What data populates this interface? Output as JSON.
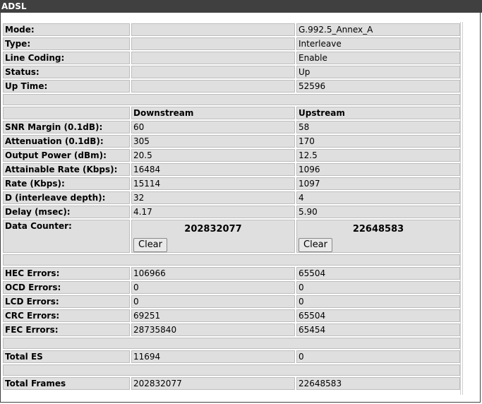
{
  "header": {
    "title": "ADSL"
  },
  "info_rows": [
    {
      "label": "Mode:",
      "value": "G.992.5_Annex_A"
    },
    {
      "label": "Type:",
      "value": "Interleave"
    },
    {
      "label": "Line Coding:",
      "value": "Enable"
    },
    {
      "label": "Status:",
      "value": "Up"
    },
    {
      "label": "Up Time:",
      "value": "52596"
    }
  ],
  "columns": {
    "downstream": "Downstream",
    "upstream": "Upstream"
  },
  "stats_rows": [
    {
      "label": "SNR Margin (0.1dB):",
      "down": "60",
      "up": "58"
    },
    {
      "label": "Attenuation (0.1dB):",
      "down": "305",
      "up": "170"
    },
    {
      "label": "Output Power (dBm):",
      "down": "20.5",
      "up": "12.5"
    },
    {
      "label": "Attainable Rate (Kbps):",
      "down": "16484",
      "up": "1096"
    },
    {
      "label": "Rate (Kbps):",
      "down": "15114",
      "up": "1097"
    },
    {
      "label": "D (interleave depth):",
      "down": "32",
      "up": "4"
    },
    {
      "label": "Delay (msec):",
      "down": "4.17",
      "up": "5.90"
    }
  ],
  "data_counter": {
    "label": "Data Counter:",
    "down": "202832077",
    "up": "22648583",
    "clear_label": "Clear"
  },
  "error_rows": [
    {
      "label": "HEC Errors:",
      "down": "106966",
      "up": "65504"
    },
    {
      "label": "OCD Errors:",
      "down": "0",
      "up": "0"
    },
    {
      "label": "LCD Errors:",
      "down": "0",
      "up": "0"
    },
    {
      "label": "CRC Errors:",
      "down": "69251",
      "up": "65504"
    },
    {
      "label": "FEC Errors:",
      "down": "28735840",
      "up": "65454"
    }
  ],
  "total_es": {
    "label": "Total ES",
    "down": "11694",
    "up": "0"
  },
  "total_frames": {
    "label": "Total Frames",
    "down": "202832077",
    "up": "22648583"
  }
}
